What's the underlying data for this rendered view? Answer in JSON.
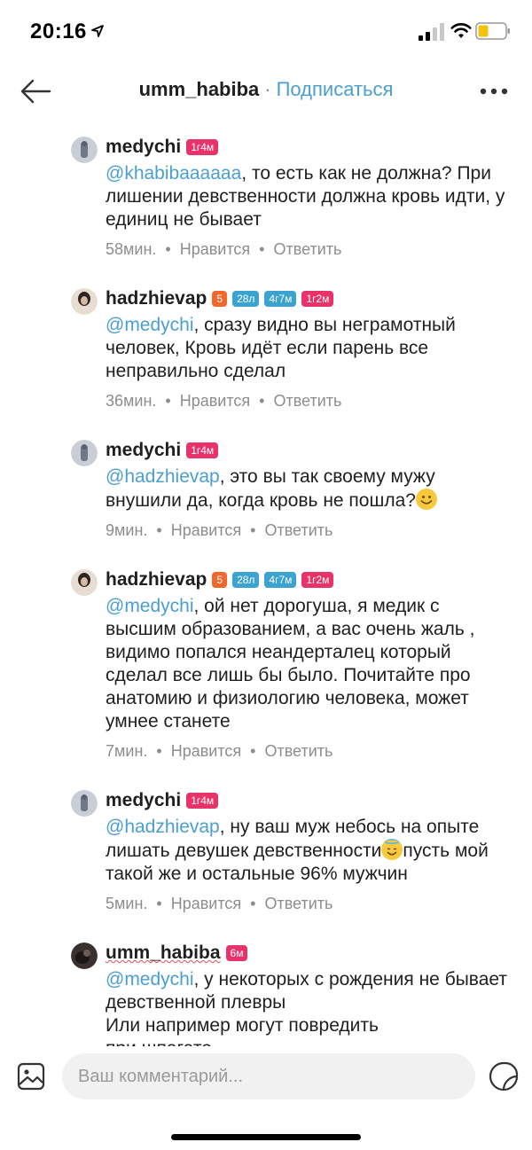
{
  "status_bar": {
    "time": "20:16"
  },
  "header": {
    "username": "umm_habiba",
    "separator": "·",
    "follow_label": "Подписаться"
  },
  "colors": {
    "mention": "#4a9fd0",
    "badge_pink": "#e8336a",
    "badge_orange": "#f0682c",
    "badge_blue": "#3aa3cf"
  },
  "comments": [
    {
      "username": "medychi",
      "badges": [
        {
          "label": "1г4м",
          "color": "badge_pink"
        }
      ],
      "mention": "@khabibaaaaaa",
      "text": ", то есть как не должна? При лишении девственности должна кровь идти, у единиц не бывает",
      "time": "58мин.",
      "like_label": "Нравится",
      "reply_label": "Ответить"
    },
    {
      "username": "hadzhievap",
      "badges": [
        {
          "label": "5",
          "color": "badge_orange"
        },
        {
          "label": "28л",
          "color": "badge_blue"
        },
        {
          "label": "4г7м",
          "color": "badge_blue"
        },
        {
          "label": "1г2м",
          "color": "badge_pink"
        }
      ],
      "mention": "@medychi",
      "text": ", сразу видно вы негрaмотный человек, Кровь идёт если парень все неправильно сделал",
      "time": "36мин.",
      "like_label": "Нравится",
      "reply_label": "Ответить"
    },
    {
      "username": "medychi",
      "badges": [
        {
          "label": "1г4м",
          "color": "badge_pink"
        }
      ],
      "mention": "@hadzhievap",
      "text": ", это вы так своему мужу внушили да, когда кровь не пошла?",
      "emoji": "smiling-face",
      "time": "9мин.",
      "like_label": "Нравится",
      "reply_label": "Ответить"
    },
    {
      "username": "hadzhievap",
      "badges": [
        {
          "label": "5",
          "color": "badge_orange"
        },
        {
          "label": "28л",
          "color": "badge_blue"
        },
        {
          "label": "4г7м",
          "color": "badge_blue"
        },
        {
          "label": "1г2м",
          "color": "badge_pink"
        }
      ],
      "mention": "@medychi",
      "text": ", ой нет дорогуша, я медик с высшим образованием, а вас очень жаль , видимо попался неандерталец который сделал все лишь бы было. Почитайте про анатомию и физиологию человека, может умнее станете",
      "time": "7мин.",
      "like_label": "Нравится",
      "reply_label": "Ответить"
    },
    {
      "username": "medychi",
      "badges": [
        {
          "label": "1г4м",
          "color": "badge_pink"
        }
      ],
      "mention": "@hadzhievap",
      "text_before_emoji": ", ну ваш муж небось на опыте лишать девушек девственности",
      "emoji": "halo-face",
      "text": "пусть мой такой же и остальные 96% мужчин",
      "time": "5мин.",
      "like_label": "Нравится",
      "reply_label": "Ответить"
    },
    {
      "username": "umm_habiba",
      "badges": [
        {
          "label": "6м",
          "color": "badge_pink"
        }
      ],
      "mention": "@medychi",
      "text": ", у некоторых с рождения не бывает девственной плевры",
      "text_line2": "Или например могут повредить",
      "text_line3": "при шпагате"
    }
  ],
  "composer": {
    "placeholder": "Ваш комментарий..."
  }
}
